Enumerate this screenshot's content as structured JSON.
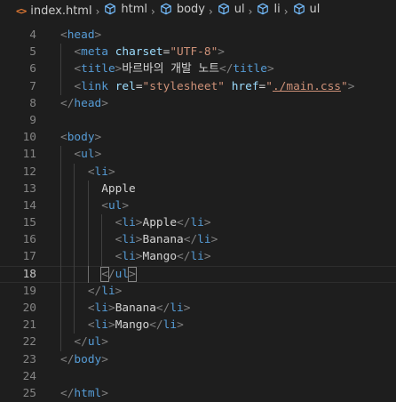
{
  "breadcrumb": {
    "file": "index.html",
    "file_icon_glyph": "<>",
    "file_icon": "html-file-icon",
    "symbol_icon": "symbol-cube-icon",
    "items": [
      "html",
      "body",
      "ul",
      "li",
      "ul"
    ]
  },
  "editor": {
    "language": "html",
    "active_line": 18,
    "lines": [
      {
        "number": "4",
        "text": "<head>"
      },
      {
        "number": "5",
        "text": "  <meta charset=\"UTF-8\">"
      },
      {
        "number": "6",
        "text": "  <title>바르바의 개발 노트</title>"
      },
      {
        "number": "7",
        "text": "  <link rel=\"stylesheet\" href=\"./main.css\">"
      },
      {
        "number": "8",
        "text": "</head>"
      },
      {
        "number": "9",
        "text": ""
      },
      {
        "number": "10",
        "text": "<body>"
      },
      {
        "number": "11",
        "text": "  <ul>"
      },
      {
        "number": "12",
        "text": "    <li>"
      },
      {
        "number": "13",
        "text": "      Apple"
      },
      {
        "number": "14",
        "text": "      <ul>"
      },
      {
        "number": "15",
        "text": "        <li>Apple</li>"
      },
      {
        "number": "16",
        "text": "        <li>Banana</li>"
      },
      {
        "number": "17",
        "text": "        <li>Mango</li>"
      },
      {
        "number": "18",
        "text": "      </ul>"
      },
      {
        "number": "19",
        "text": "    </li>"
      },
      {
        "number": "20",
        "text": "    <li>Banana</li>"
      },
      {
        "number": "21",
        "text": "    <li>Mango</li>"
      },
      {
        "number": "22",
        "text": "  </ul>"
      },
      {
        "number": "23",
        "text": "</body>"
      },
      {
        "number": "24",
        "text": ""
      },
      {
        "number": "25",
        "text": "</html>"
      }
    ]
  },
  "colors": {
    "background": "#1e1e1e",
    "tag": "#569cd6",
    "bracket": "#808080",
    "attribute": "#9cdcfe",
    "string": "#ce9178",
    "text": "#d4d4d4",
    "line_number": "#858585",
    "file_icon": "#e37933",
    "symbol_icon": "#75beff"
  }
}
